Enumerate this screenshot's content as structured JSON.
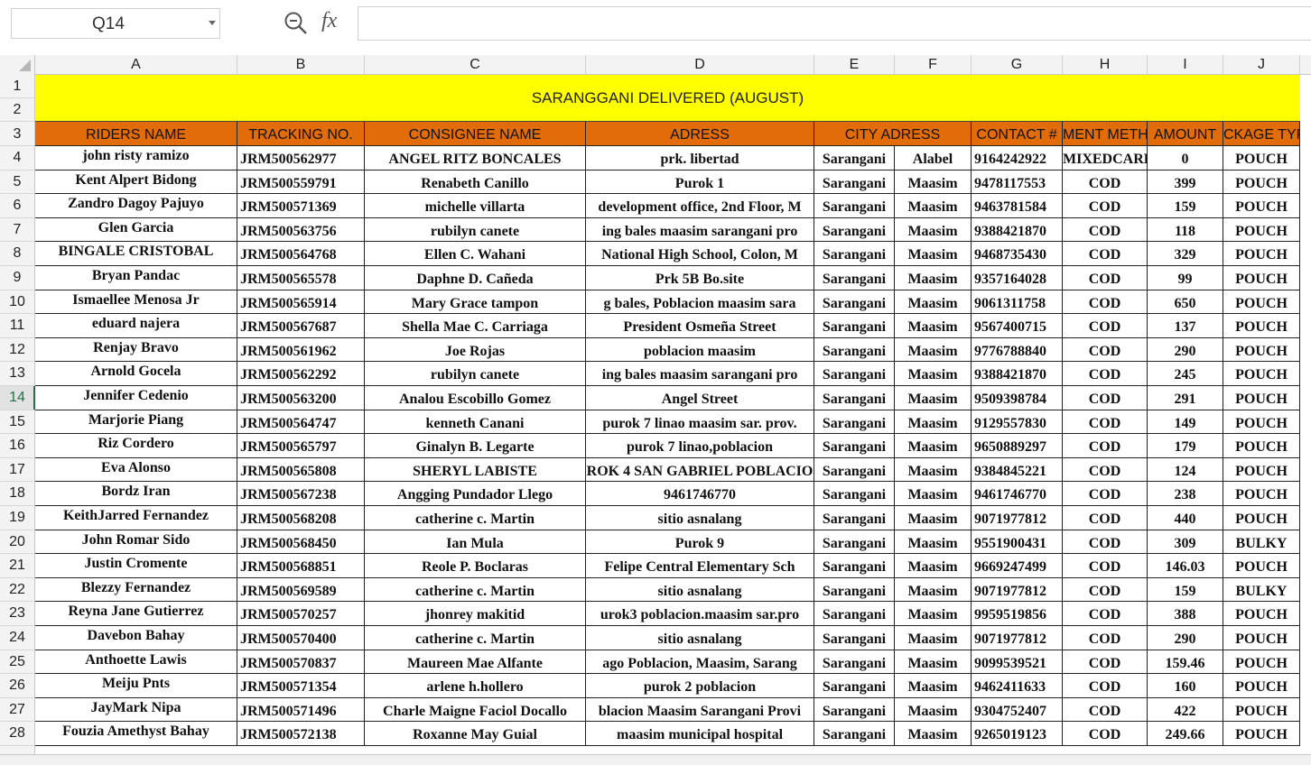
{
  "formula_bar": {
    "name_box": "Q14",
    "fx_label": "fx",
    "formula": ""
  },
  "columns": [
    "A",
    "B",
    "C",
    "D",
    "E",
    "F",
    "G",
    "H",
    "I",
    "J"
  ],
  "rows": [
    "1",
    "2",
    "3",
    "4",
    "5",
    "6",
    "7",
    "8",
    "9",
    "10",
    "11",
    "12",
    "13",
    "14",
    "15",
    "16",
    "17",
    "18",
    "19",
    "20",
    "21",
    "22",
    "23",
    "24",
    "25",
    "26",
    "27",
    "28"
  ],
  "active_row": "14",
  "sheet": {
    "title": "SARANGGANI DELIVERED (AUGUST)",
    "headers": [
      "RIDERS NAME",
      "TRACKING NO.",
      "CONSIGNEE NAME",
      "ADRESS",
      "CITY ADRESS",
      "CONTACT #",
      "MENT METH",
      "AMOUNT",
      "CKAGE TYPE"
    ],
    "records": [
      [
        "john risty ramizo",
        "JRM500562977",
        "ANGEL RITZ BONCALES",
        "prk. libertad",
        "Sarangani",
        "Alabel",
        "9164242922",
        "MIXEDCARD",
        "0",
        "POUCH"
      ],
      [
        "Kent Alpert Bidong",
        "JRM500559791",
        "Renabeth Canillo",
        "Purok 1",
        "Sarangani",
        "Maasim",
        "9478117553",
        "COD",
        "399",
        "POUCH"
      ],
      [
        "Zandro Dagoy Pajuyo",
        "JRM500571369",
        "michelle villarta",
        "development office, 2nd Floor, M",
        "Sarangani",
        "Maasim",
        "9463781584",
        "COD",
        "159",
        "POUCH"
      ],
      [
        "Glen Garcia",
        "JRM500563756",
        "rubilyn canete",
        "ing bales maasim sarangani pro",
        "Sarangani",
        "Maasim",
        "9388421870",
        "COD",
        "118",
        "POUCH"
      ],
      [
        "BINGALE CRISTOBAL",
        "JRM500564768",
        "Ellen C. Wahani",
        "National High School, Colon, M",
        "Sarangani",
        "Maasim",
        "9468735430",
        "COD",
        "329",
        "POUCH"
      ],
      [
        "Bryan Pandac",
        "JRM500565578",
        "Daphne D. Cañeda",
        "Prk 5B Bo.site",
        "Sarangani",
        "Maasim",
        "9357164028",
        "COD",
        "99",
        "POUCH"
      ],
      [
        "Ismaellee Menosa Jr",
        "JRM500565914",
        "Mary Grace tampon",
        "g bales, Poblacion maasim sara",
        "Sarangani",
        "Maasim",
        "9061311758",
        "COD",
        "650",
        "POUCH"
      ],
      [
        "eduard najera",
        "JRM500567687",
        "Shella Mae C. Carriaga",
        "President Osmeña Street",
        "Sarangani",
        "Maasim",
        "9567400715",
        "COD",
        "137",
        "POUCH"
      ],
      [
        "Renjay Bravo",
        "JRM500561962",
        "Joe Rojas",
        "poblacion maasim",
        "Sarangani",
        "Maasim",
        "9776788840",
        "COD",
        "290",
        "POUCH"
      ],
      [
        "Arnold Gocela",
        "JRM500562292",
        "rubilyn canete",
        "ing bales maasim sarangani pro",
        "Sarangani",
        "Maasim",
        "9388421870",
        "COD",
        "245",
        "POUCH"
      ],
      [
        "Jennifer Cedenio",
        "JRM500563200",
        "Analou Escobillo Gomez",
        "Angel Street",
        "Sarangani",
        "Maasim",
        "9509398784",
        "COD",
        "291",
        "POUCH"
      ],
      [
        "Marjorie Piang",
        "JRM500564747",
        "kenneth Canani",
        "purok 7 linao maasim sar. prov.",
        "Sarangani",
        "Maasim",
        "9129557830",
        "COD",
        "149",
        "POUCH"
      ],
      [
        "Riz Cordero",
        "JRM500565797",
        "Ginalyn B. Legarte",
        "purok 7 linao,poblacion",
        "Sarangani",
        "Maasim",
        "9650889297",
        "COD",
        "179",
        "POUCH"
      ],
      [
        "Eva Alonso",
        "JRM500565808",
        "SHERYL LABISTE",
        "ROK 4 SAN GABRIEL POBLACIO",
        "Sarangani",
        "Maasim",
        "9384845221",
        "COD",
        "124",
        "POUCH"
      ],
      [
        "Bordz Iran",
        "JRM500567238",
        "Angging Pundador Llego",
        "9461746770",
        "Sarangani",
        "Maasim",
        "9461746770",
        "COD",
        "238",
        "POUCH"
      ],
      [
        "KeithJarred Fernandez",
        "JRM500568208",
        "catherine c. Martin",
        "sitio asnalang",
        "Sarangani",
        "Maasim",
        "9071977812",
        "COD",
        "440",
        "POUCH"
      ],
      [
        "John Romar Sido",
        "JRM500568450",
        "Ian Mula",
        "Purok 9",
        "Sarangani",
        "Maasim",
        "9551900431",
        "COD",
        "309",
        "BULKY"
      ],
      [
        "Justin Cromente",
        "JRM500568851",
        "Reole P. Boclaras",
        "Felipe Central Elementary Sch",
        "Sarangani",
        "Maasim",
        "9669247499",
        "COD",
        "146.03",
        "POUCH"
      ],
      [
        "Blezzy Fernandez",
        "JRM500569589",
        "catherine c. Martin",
        "sitio asnalang",
        "Sarangani",
        "Maasim",
        "9071977812",
        "COD",
        "159",
        "BULKY"
      ],
      [
        "Reyna Jane Gutierrez",
        "JRM500570257",
        "jhonrey makitid",
        "urok3 poblacion.maasim sar.pro",
        "Sarangani",
        "Maasim",
        "9959519856",
        "COD",
        "388",
        "POUCH"
      ],
      [
        "Davebon Bahay",
        "JRM500570400",
        "catherine c. Martin",
        "sitio asnalang",
        "Sarangani",
        "Maasim",
        "9071977812",
        "COD",
        "290",
        "POUCH"
      ],
      [
        "Anthoette Lawis",
        "JRM500570837",
        "Maureen Mae Alfante",
        "ago Poblacion, Maasim, Sarang",
        "Sarangani",
        "Maasim",
        "9099539521",
        "COD",
        "159.46",
        "POUCH"
      ],
      [
        "Meiju Pnts",
        "JRM500571354",
        "arlene h.hollero",
        "purok 2 poblacion",
        "Sarangani",
        "Maasim",
        "9462411633",
        "COD",
        "160",
        "POUCH"
      ],
      [
        "JayMark Nipa",
        "JRM500571496",
        "Charle Maigne Faciol Docallo",
        "blacion Maasim Sarangani Provi",
        "Sarangani",
        "Maasim",
        "9304752407",
        "COD",
        "422",
        "POUCH"
      ],
      [
        "Fouzia Amethyst Bahay",
        "JRM500572138",
        "Roxanne May Guial",
        "maasim municipal hospital",
        "Sarangani",
        "Maasim",
        "9265019123",
        "COD",
        "249.66",
        "POUCH"
      ]
    ]
  }
}
